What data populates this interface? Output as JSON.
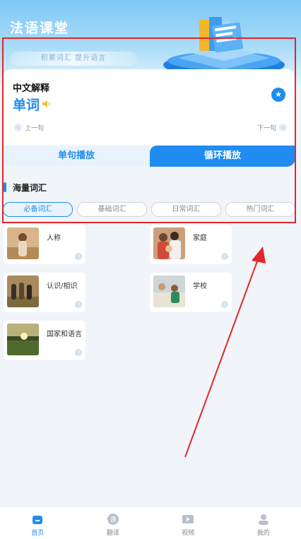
{
  "header": {
    "app_title": "法语课堂",
    "slogan": "积累词汇 提升语言"
  },
  "word_card": {
    "label": "中文解释",
    "word": "单词",
    "prev_label": "上一句",
    "next_label": "下一句",
    "single_play_label": "单句播放",
    "loop_play_label": "循环播放"
  },
  "section": {
    "title": "海量词汇",
    "tabs": [
      {
        "label": "必备词汇",
        "active": true
      },
      {
        "label": "基础词汇",
        "active": false
      },
      {
        "label": "日常词汇",
        "active": false
      },
      {
        "label": "热门词汇",
        "active": false
      }
    ]
  },
  "topics": [
    {
      "label": "人称",
      "icon": "photo-person"
    },
    {
      "label": "家庭",
      "icon": "photo-family"
    },
    {
      "label": "认识/相识",
      "icon": "photo-friends"
    },
    {
      "label": "学校",
      "icon": "photo-school"
    },
    {
      "label": "国家和语言",
      "icon": "photo-landscape"
    }
  ],
  "tabbar": {
    "items": [
      {
        "label": "首页",
        "icon": "home-icon",
        "active": true
      },
      {
        "label": "翻译",
        "icon": "translate-icon",
        "active": false
      },
      {
        "label": "视频",
        "icon": "video-icon",
        "active": false
      },
      {
        "label": "我的",
        "icon": "profile-icon",
        "active": false
      }
    ]
  },
  "colors": {
    "accent": "#1f8cf0",
    "annotation": "#e2262b",
    "background": "#f1f4f8"
  }
}
